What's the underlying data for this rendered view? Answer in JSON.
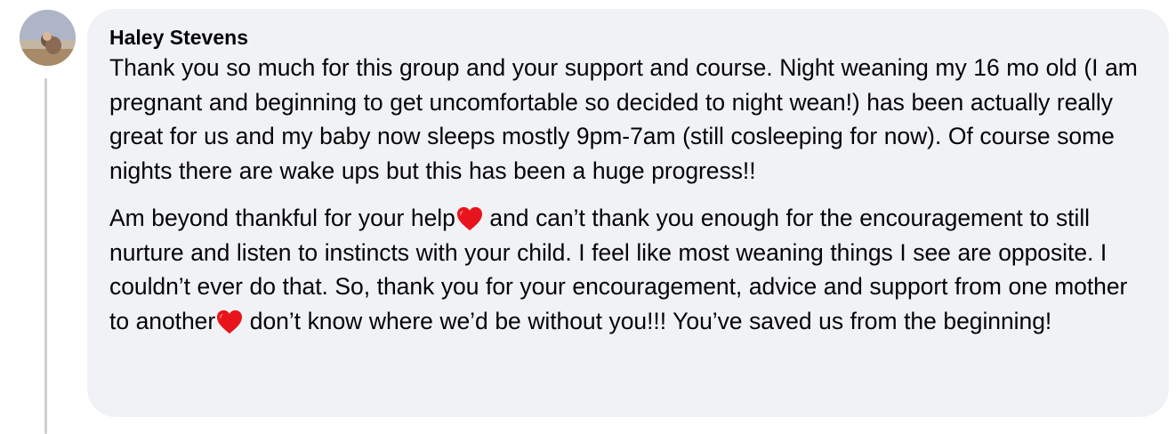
{
  "comment": {
    "author": "Haley Stevens",
    "paragraph_1": "Thank you so much for this group and your support and course. Night weaning my 16 mo old (I am pregnant and beginning to get uncomfortable so decided to night wean!) has been actually really great for us and my baby now sleeps mostly 9pm-7am (still cosleeping for now). Of course some nights there are wake ups but this has been a huge progress!!",
    "paragraph_2_part_1": "Am beyond thankful for your help",
    "paragraph_2_part_2": " and can’t thank you enough for the encouragement to still nurture and listen to instincts with your child. I feel like most weaning things I see are opposite. I couldn’t ever do that. So, thank you for your encouragement, advice and support from one mother to another",
    "paragraph_2_part_3": " don’t know where we’d be without you!!! You’ve saved us from the beginning!",
    "emoji": "red-heart-emoji"
  },
  "colors": {
    "bubble_background": "#f0f2f5",
    "thread_line": "#ced0d4",
    "text": "#050505",
    "heart": "#e8141c"
  }
}
